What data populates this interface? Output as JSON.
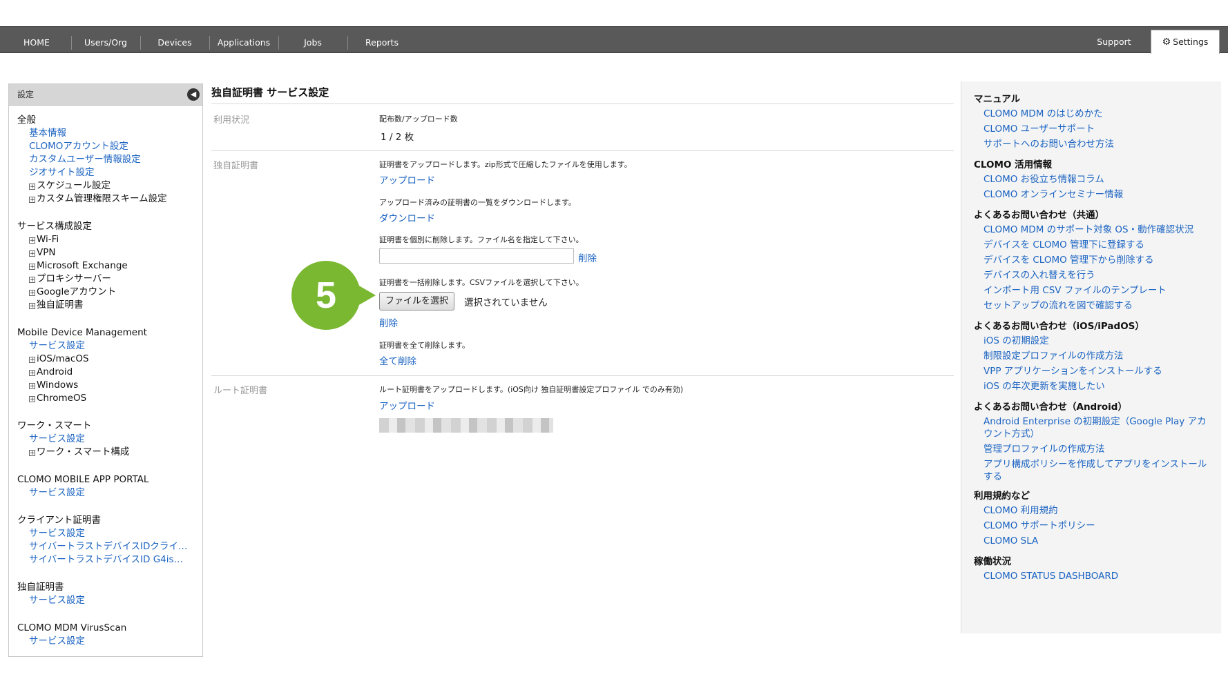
{
  "nav": {
    "items": [
      "HOME",
      "Users/Org",
      "Devices",
      "Applications",
      "Jobs",
      "Reports"
    ],
    "support": "Support",
    "settings": "Settings"
  },
  "sidebar": {
    "header": "設定",
    "sections": [
      {
        "title": "全般",
        "entries": [
          {
            "type": "link",
            "label": "基本情報"
          },
          {
            "type": "link",
            "label": "CLOMOアカウント設定"
          },
          {
            "type": "link",
            "label": "カスタムユーザー情報設定"
          },
          {
            "type": "link",
            "label": "ジオサイト設定"
          },
          {
            "type": "expand",
            "label": "スケジュール設定"
          },
          {
            "type": "expand",
            "label": "カスタム管理権限スキーム設定"
          }
        ]
      },
      {
        "title": "サービス構成設定",
        "entries": [
          {
            "type": "expand",
            "label": "Wi-Fi"
          },
          {
            "type": "expand",
            "label": "VPN"
          },
          {
            "type": "expand",
            "label": "Microsoft Exchange"
          },
          {
            "type": "expand",
            "label": "プロキシサーバー"
          },
          {
            "type": "expand",
            "label": "Googleアカウント"
          },
          {
            "type": "expand",
            "label": "独自証明書"
          }
        ]
      },
      {
        "title": "Mobile Device Management",
        "entries": [
          {
            "type": "link",
            "label": "サービス設定"
          },
          {
            "type": "expand",
            "label": "iOS/macOS"
          },
          {
            "type": "expand",
            "label": "Android"
          },
          {
            "type": "expand",
            "label": "Windows"
          },
          {
            "type": "expand",
            "label": "ChromeOS"
          }
        ]
      },
      {
        "title": "ワーク・スマート",
        "entries": [
          {
            "type": "link",
            "label": "サービス設定"
          },
          {
            "type": "expand",
            "label": "ワーク・スマート構成"
          }
        ]
      },
      {
        "title": "CLOMO MOBILE APP PORTAL",
        "entries": [
          {
            "type": "link",
            "label": "サービス設定"
          }
        ]
      },
      {
        "title": "クライアント証明書",
        "entries": [
          {
            "type": "link",
            "label": "サービス設定"
          },
          {
            "type": "link",
            "label": "サイバートラストデバイスIDクライ…"
          },
          {
            "type": "link",
            "label": "サイバートラストデバイスID G4is…"
          }
        ]
      },
      {
        "title": "独自証明書",
        "entries": [
          {
            "type": "link",
            "label": "サービス設定"
          }
        ]
      },
      {
        "title": "CLOMO MDM VirusScan",
        "entries": [
          {
            "type": "link",
            "label": "サービス設定"
          }
        ]
      }
    ]
  },
  "main": {
    "title": "独自証明書 サービス設定",
    "usage": {
      "label": "利用状況",
      "desc": "配布数/アップロード数",
      "value": "1 / 2 枚"
    },
    "custom_cert": {
      "label": "独自証明書",
      "upload_desc": "証明書をアップロードします。zip形式で圧縮したファイルを使用します。",
      "upload_link": "アップロード",
      "download_desc": "アップロード済みの証明書の一覧をダウンロードします。",
      "download_link": "ダウンロード",
      "delete_one_desc": "証明書を個別に削除します。ファイル名を指定して下さい。",
      "delete_one_input_value": "",
      "delete_one_link": "削除",
      "bulk_desc": "証明書を一括削除します。CSVファイルを選択して下さい。",
      "choose_file": "ファイルを選択",
      "no_file": "選択されていません",
      "bulk_delete_link": "削除",
      "delete_all_desc": "証明書を全て削除します。",
      "delete_all_link": "全て削除"
    },
    "root_cert": {
      "label": "ルート証明書",
      "desc": "ルート証明書をアップロードします。(iOS向け 独自証明書設定プロファイル でのみ有効)",
      "upload_link": "アップロード"
    },
    "step_badge": "5"
  },
  "right_panel": {
    "groups": [
      {
        "title": "マニュアル",
        "links": [
          "CLOMO MDM のはじめかた",
          "CLOMO ユーザーサポート",
          "サポートへのお問い合わせ方法"
        ]
      },
      {
        "title": "CLOMO 活用情報",
        "links": [
          "CLOMO お役立ち情報コラム",
          "CLOMO オンラインセミナー情報"
        ]
      },
      {
        "title": "よくあるお問い合わせ（共通）",
        "links": [
          "CLOMO MDM のサポート対象 OS・動作確認状況",
          "デバイスを CLOMO 管理下に登録する",
          "デバイスを CLOMO 管理下から削除する",
          "デバイスの入れ替えを行う",
          "インポート用 CSV ファイルのテンプレート",
          "セットアップの流れを図で確認する"
        ]
      },
      {
        "title": "よくあるお問い合わせ（iOS/iPadOS）",
        "links": [
          "iOS の初期設定",
          "制限設定プロファイルの作成方法",
          "VPP アプリケーションをインストールする",
          "iOS の年次更新を実施したい"
        ]
      },
      {
        "title": "よくあるお問い合わせ（Android）",
        "links": [
          "Android Enterprise の初期設定（Google Play アカウント方式）",
          "管理プロファイルの作成方法",
          "アプリ構成ポリシーを作成してアプリをインストールする"
        ]
      },
      {
        "title": "利用規約など",
        "links": [
          "CLOMO 利用規約",
          "CLOMO サポートポリシー",
          "CLOMO SLA"
        ]
      },
      {
        "title": "稼働状況",
        "links": [
          "CLOMO STATUS DASHBOARD"
        ]
      }
    ]
  }
}
